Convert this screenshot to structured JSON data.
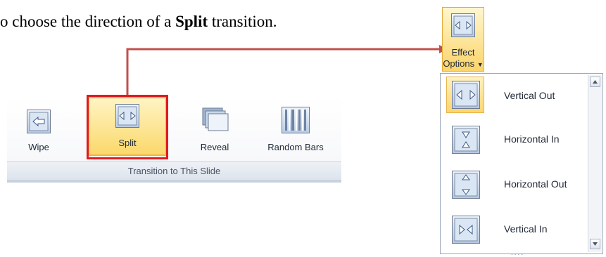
{
  "caption": {
    "prefix": "o choose the direction of a ",
    "bold": "Split",
    "suffix": " transition."
  },
  "ribbon": {
    "buttons": [
      {
        "label": "Wipe",
        "icon": "wipe-icon"
      },
      {
        "label": "Split",
        "icon": "split-icon",
        "selected": true
      },
      {
        "label": "Reveal",
        "icon": "reveal-icon"
      },
      {
        "label": "Random Bars",
        "icon": "random-bars-icon"
      }
    ],
    "group_label": "Transition to This Slide"
  },
  "effect_options": {
    "line1": "Effect",
    "line2": "Options",
    "icon": "split-vertical-out-icon"
  },
  "dropdown": {
    "items": [
      {
        "label": "Vertical Out",
        "icon": "vertical-out-icon",
        "selected": true
      },
      {
        "label": "Horizontal In",
        "icon": "horizontal-in-icon"
      },
      {
        "label": "Horizontal Out",
        "icon": "horizontal-out-icon"
      },
      {
        "label": "Vertical In",
        "icon": "vertical-in-icon"
      }
    ]
  },
  "colors": {
    "highlight_border": "#e2191c",
    "callout_line": "#c0504d",
    "selected_fill": "#fbd56f"
  }
}
